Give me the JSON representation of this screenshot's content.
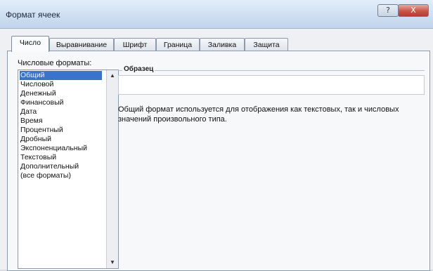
{
  "window": {
    "title": "Формат ячеек",
    "help_label": "?",
    "close_label": "X"
  },
  "tabs": [
    {
      "label": "Число",
      "active": true
    },
    {
      "label": "Выравнивание",
      "active": false
    },
    {
      "label": "Шрифт",
      "active": false
    },
    {
      "label": "Граница",
      "active": false
    },
    {
      "label": "Заливка",
      "active": false
    },
    {
      "label": "Защита",
      "active": false
    }
  ],
  "number_formats": {
    "label": "Числовые форматы:",
    "items": [
      "Общий",
      "Числовой",
      "Денежный",
      "Финансовый",
      "Дата",
      "Время",
      "Процентный",
      "Дробный",
      "Экспоненциальный",
      "Текстовый",
      "Дополнительный",
      "(все форматы)"
    ],
    "selected": "Общий"
  },
  "sample": {
    "label": "Образец",
    "value": ""
  },
  "description": "Общий формат используется для отображения как текстовых, так и числовых значений произвольного типа.",
  "colors": {
    "selection": "#3a73cc",
    "close_button": "#c9554a"
  }
}
